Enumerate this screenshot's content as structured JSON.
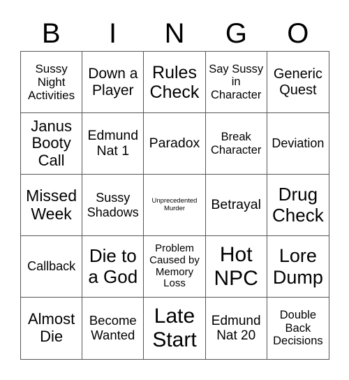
{
  "header": {
    "letters": [
      "B",
      "I",
      "N",
      "G",
      "O"
    ]
  },
  "cells": [
    "Sussy Night Activities",
    "Down a Player",
    "Rules Check",
    "Say Sussy in Character",
    "Generic Quest",
    "Janus Booty Call",
    "Edmund Nat 1",
    "Paradox",
    "Break Character",
    "Deviation",
    "Missed Week",
    "Sussy Shadows",
    "Unprecedented Murder",
    "Betrayal",
    "Drug Check",
    "Callback",
    "Die to a God",
    "Problem Caused by Memory Loss",
    "Hot NPC",
    "Lore Dump",
    "Almost Die",
    "Become Wanted",
    "Late Start",
    "Edmund Nat 20",
    "Double Back Decisions"
  ]
}
